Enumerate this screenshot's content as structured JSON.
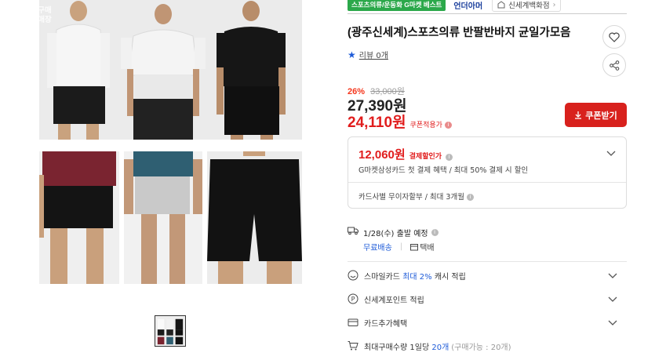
{
  "gallery": {
    "badge": "구매\n매장"
  },
  "top": {
    "best_tag": "스포츠의류/운동화 G마켓 베스트",
    "brand": "언더아머",
    "store": "신세계백화점"
  },
  "product": {
    "title": "(광주신세계)스포츠의류 반팔반바지 균일가모음",
    "review_label": "리뷰 0개"
  },
  "price": {
    "discount_rate": "26%",
    "original": "33,000원",
    "sale": "27,390원",
    "coupon_price": "24,110원",
    "coupon_note": "쿠폰적용가",
    "coupon_button": "쿠폰받기"
  },
  "payment": {
    "amount": "12,060원",
    "label": "결제할인가",
    "sub": "G마켓삼성카드 첫 결제 혜택 / 최대 50% 결제 시 할인",
    "installment": "카드사별 무이자할부 / 최대 3개월"
  },
  "shipping": {
    "date": "1/28(수) 출발 예정",
    "free": "무료배송",
    "parcel": "택배"
  },
  "benefits": {
    "smile_prefix": "스마일카드",
    "smile_highlight": "최대 2%",
    "smile_suffix": "캐시 적립",
    "ssg_point": "신세계포인트 적립",
    "card_extra": "카드추가혜택",
    "max_prefix": "최대구매수량 1일당",
    "max_highlight": "20개",
    "max_note": "(구매가능 : 20개)"
  },
  "colors": {
    "accent_red": "#d8211d",
    "price_red": "#e11d1d",
    "link_blue": "#1e5bd8",
    "best_green": "#2ba84a"
  },
  "icons": [
    "heart-icon",
    "share-icon",
    "star-icon",
    "download-icon",
    "truck-icon",
    "box-icon",
    "smile-icon",
    "point-icon",
    "card-icon",
    "cart-icon",
    "chevron-down-icon",
    "store-icon"
  ]
}
